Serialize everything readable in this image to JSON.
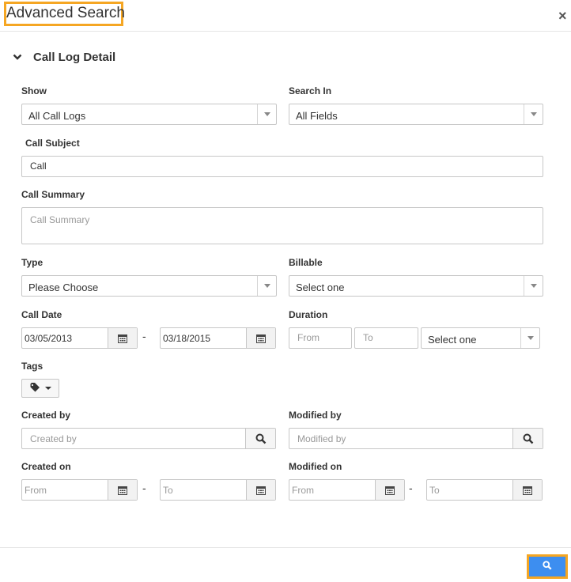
{
  "dialog": {
    "title": "Advanced Search",
    "close_label": "×",
    "section_title": "Call Log Detail"
  },
  "labels": {
    "show": "Show",
    "search_in": "Search In",
    "call_subject": "Call Subject",
    "call_summary": "Call Summary",
    "type": "Type",
    "billable": "Billable",
    "call_date": "Call Date",
    "duration": "Duration",
    "tags": "Tags",
    "created_by": "Created by",
    "modified_by": "Modified by",
    "created_on": "Created on",
    "modified_on": "Modified on"
  },
  "fields": {
    "show": "All Call Logs",
    "search_in": "All Fields",
    "call_subject": "Call",
    "call_summary_placeholder": "Call Summary",
    "type": "Please Choose",
    "billable": "Select one",
    "call_date_from": "03/05/2013",
    "call_date_to": "03/18/2015",
    "duration_from_placeholder": "From",
    "duration_to_placeholder": "To",
    "duration_unit": "Select one",
    "created_by_placeholder": "Created by",
    "modified_by_placeholder": "Modified by",
    "created_on_from_placeholder": "From",
    "created_on_to_placeholder": "To",
    "modified_on_from_placeholder": "From",
    "modified_on_to_placeholder": "To",
    "range_separator": "-"
  },
  "colors": {
    "highlight": "#f5a623",
    "primary_button": "#3d8ef0"
  },
  "icons": {
    "calendar": "calendar-icon",
    "search": "search-icon",
    "tag": "tag-icon",
    "chevron": "chevron-down-icon",
    "close": "close-icon"
  }
}
